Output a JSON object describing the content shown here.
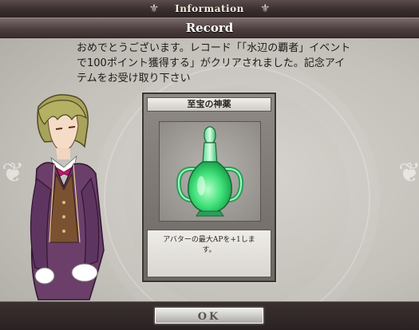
{
  "topbar": {
    "title": "Information",
    "left_ornament": "⚜",
    "right_ornament": "⚜"
  },
  "dialog": {
    "title": "Record",
    "message": "おめでとうございます。レコード「「水辺の覇者」イベント\nで100ポイント獲得する」がクリアされました。記念アイ\nテムをお受け取り下さい"
  },
  "reward_card": {
    "item_name": "至宝の神薬",
    "description": "アバターの最大APを+1しま\nす。",
    "icon": "potion-flask-icon"
  },
  "character": {
    "icon": "butler-character-portrait"
  },
  "footer": {
    "ok_label": "OK"
  },
  "colors": {
    "potion_green": "#3fe07a",
    "frame_dark": "#3a2e2e",
    "panel_bg": "#c4c0ba"
  }
}
